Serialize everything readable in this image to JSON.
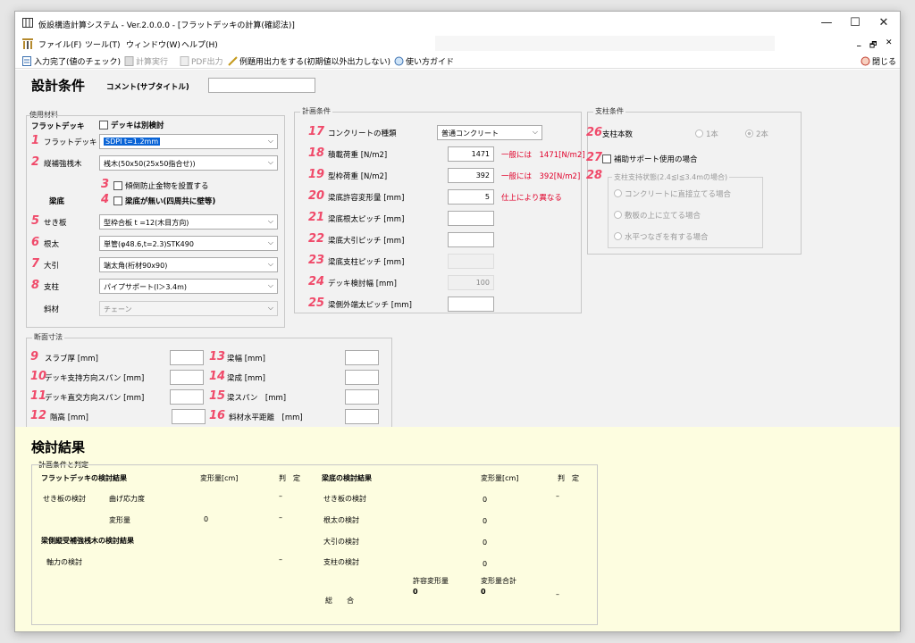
{
  "window": {
    "title": "仮設構造計算システム - Ver.2.0.0.0 - [フラットデッキの計算(確認法)]",
    "controls": {
      "minimize": "—",
      "maximize": "☐",
      "close": "✕"
    },
    "mdi_controls": {
      "minimize": "_",
      "restore": "🗗",
      "close": "✕"
    }
  },
  "menu": [
    "ファイル(F)",
    "ツール(T)",
    "ウィンドウ(W)",
    "ヘルプ(H)"
  ],
  "toolbar": {
    "input_complete": "入力完了(値のチェック)",
    "calc": "計算実行",
    "pdf": "PDF出力",
    "example": "例題用出力をする(初期値以外出力しない)",
    "guide": "使い方ガイド",
    "close": "閉じる"
  },
  "design": {
    "heading": "設計条件",
    "comment_label": "コメント(サブタイトル)",
    "comment_value": ""
  },
  "materials": {
    "group_title": "使用材料",
    "flat_deck_heading": "フラットデッキ",
    "separate_check": "デッキは別検討",
    "beam_bottom_heading": "梁底",
    "items": [
      {
        "num": "1",
        "label": "フラットデッキ",
        "value": "SDPI t=1.2mm"
      },
      {
        "num": "2",
        "label": "縦補強桟木",
        "value": "桟木(50x50(25x50指合せ))"
      },
      {
        "num": "5",
        "label": "せき板",
        "value": "型枠合板 t =12(木目方向)"
      },
      {
        "num": "6",
        "label": "根太",
        "value": "単管(φ48.6,t=2.3)STK490"
      },
      {
        "num": "7",
        "label": "大引",
        "value": "端太角(桁材90x90)"
      },
      {
        "num": "8",
        "label": "支柱",
        "value": "パイプサポート(l＞3.4m)"
      }
    ],
    "check3_num": "3",
    "check3_label": "傾倒防止金物を設置する",
    "check4_num": "4",
    "check4_label": "梁底が無い(四周共に壁等)",
    "diag_label": "斜材",
    "diag_value": "チェーン"
  },
  "plan": {
    "group_title": "計画条件",
    "items": [
      {
        "num": "17",
        "label": "コンクリートの種類",
        "value": "普通コンクリート",
        "note": ""
      },
      {
        "num": "18",
        "label": "積載荷重 [N/m2]",
        "value": "1471",
        "note": "一般には　1471[N/m2]"
      },
      {
        "num": "19",
        "label": "型枠荷重 [N/m2]",
        "value": "392",
        "note": "一般には　392[N/m2]"
      },
      {
        "num": "20",
        "label": "梁底許容変形量 [mm]",
        "value": "5",
        "note": "仕上により異なる"
      },
      {
        "num": "21",
        "label": "梁底根太ピッチ [mm]",
        "value": "",
        "note": ""
      },
      {
        "num": "22",
        "label": "梁底大引ピッチ [mm]",
        "value": "",
        "note": ""
      },
      {
        "num": "23",
        "label": "梁底支柱ピッチ [mm]",
        "value": "",
        "note": ""
      },
      {
        "num": "24",
        "label": "デッキ検討幅 [mm]",
        "value": "100",
        "note": ""
      },
      {
        "num": "25",
        "label": "梁側外端太ピッチ [mm]",
        "value": "",
        "note": ""
      }
    ]
  },
  "support": {
    "group_title": "支柱条件",
    "num26": "26",
    "count_label": "支柱本数",
    "opt1": "1本",
    "opt2": "2本",
    "num27": "27",
    "aux_label": "補助サポート使用の場合",
    "num28": "28",
    "state_title": "支柱支持状態(2.4≦l≦3.4mの場合)",
    "states": [
      "コンクリートに直接立てる場合",
      "敷板の上に立てる場合",
      "水平つなぎを有する場合"
    ]
  },
  "section": {
    "group_title": "断面寸法",
    "left": [
      {
        "num": "9",
        "label": "スラブ厚 [mm]"
      },
      {
        "num": "10",
        "label": "デッキ支持方向スパン [mm]"
      },
      {
        "num": "11",
        "label": "デッキ直交方向スパン [mm]"
      },
      {
        "num": "12",
        "label": "階高 [mm]"
      }
    ],
    "right": [
      {
        "num": "13",
        "label": "梁幅 [mm]"
      },
      {
        "num": "14",
        "label": "梁成 [mm]"
      },
      {
        "num": "15",
        "label": "梁スパン　[mm]"
      },
      {
        "num": "16",
        "label": "斜材水平距離　[mm]"
      }
    ]
  },
  "results": {
    "heading": "検討結果",
    "group_title": "計画条件と判定",
    "left_title": "フラットデッキの検討結果",
    "def_hdr": "変形量[cm]",
    "judge_hdr": "判　定",
    "right_title": "梁底の検討結果",
    "form_check": "せき板の検討",
    "bending": "曲げ応力度",
    "bending_val": "",
    "bending_judge": "–",
    "deform": "変形量",
    "deform_val": "0",
    "deform_judge": "–",
    "beam_side_title": "梁側縦受補強桟木の検討結果",
    "axial": "軸力の検討",
    "axial_judge": "–",
    "right_rows": [
      {
        "label": "せき板の検討",
        "val": "0",
        "judge": "–"
      },
      {
        "label": "根太の検討",
        "val": "0",
        "judge": ""
      },
      {
        "label": "大引の検討",
        "val": "0",
        "judge": ""
      },
      {
        "label": "支柱の検討",
        "val": "0",
        "judge": ""
      }
    ],
    "allow_hdr": "許容変形量",
    "sum_hdr": "変形量合計",
    "total_label": "総　　合",
    "allow_val": "0",
    "sum_val": "0",
    "total_judge": "–"
  }
}
